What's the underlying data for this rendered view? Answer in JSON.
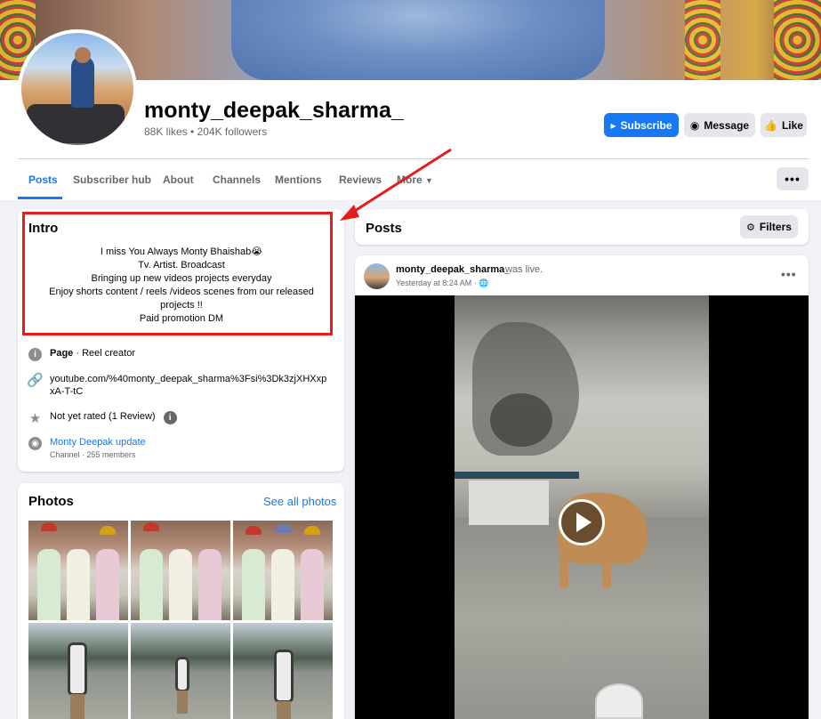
{
  "page": {
    "name": "monty_deepak_sharma_",
    "stats": "88K likes • 204K followers"
  },
  "actions": {
    "subscribe": "Subscribe",
    "message": "Message",
    "like": "Like"
  },
  "tabs": [
    {
      "label": "Posts",
      "active": true
    },
    {
      "label": "Subscriber hub"
    },
    {
      "label": "About"
    },
    {
      "label": "Channels"
    },
    {
      "label": "Mentions"
    },
    {
      "label": "Reviews"
    },
    {
      "label": "More"
    }
  ],
  "more_menu": "•••",
  "intro": {
    "title": "Intro",
    "bio": [
      "I miss You Always Monty Bhaishab😭",
      "Tv. Artist. Broadcast",
      "Bringing up new videos projects everyday",
      "Enjoy shorts content / reels /videos scenes from our released projects !!",
      "Paid promotion DM"
    ],
    "category_label": "Page",
    "category_value": " · Reel creator",
    "link": "youtube.com/%40monty_deepak_sharma%3Fsi%3Dk3zjXHXxpxA-T-tC",
    "rating": "Not yet rated (1 Review)",
    "channel_name": "Monty Deepak update",
    "channel_meta": "Channel · 255 members"
  },
  "photos": {
    "title": "Photos",
    "see_all": "See all photos"
  },
  "posts": {
    "title": "Posts",
    "filters": "Filters"
  },
  "post": {
    "author": "monty_deepak_sharma_",
    "action": "was live.",
    "time": "Yesterday at 8:24 AM · 🌐"
  },
  "colors": {
    "accent": "#1877f2",
    "highlight": "#e41c1c"
  }
}
